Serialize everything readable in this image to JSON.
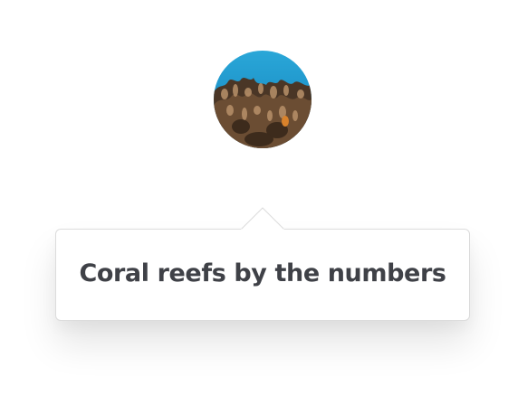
{
  "avatar": {
    "subject": "coral reef photo",
    "colors": {
      "water": "#1f9bd0",
      "coral_dark": "#3b2a1d",
      "coral_light": "#b8916a"
    }
  },
  "tooltip": {
    "title": "Coral reefs by the numbers",
    "text_color": "#3f4147",
    "border_color": "#dcdcdc"
  }
}
